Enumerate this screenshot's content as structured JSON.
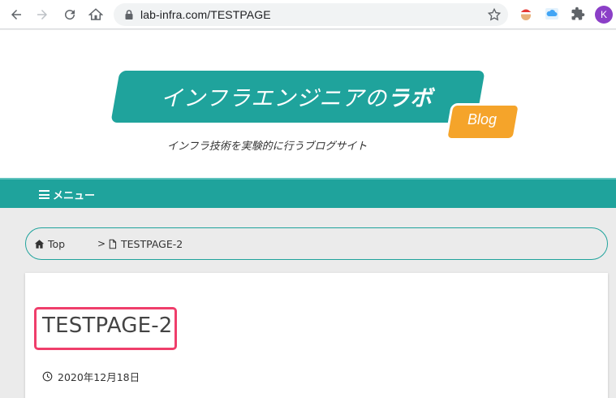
{
  "browser": {
    "url": "lab-infra.com/TESTPAGE",
    "profile_initial": "K",
    "icons": [
      "back-icon",
      "forward-icon",
      "reload-icon",
      "home-icon",
      "lock-icon",
      "star-icon",
      "extension-santa-icon",
      "extension-cloud-icon",
      "puzzle-icon"
    ]
  },
  "site": {
    "logo_main": "インフラエンジニアの",
    "logo_bold": "ラボ",
    "logo_badge": "Blog",
    "tagline": "インフラ技術を実験的に行うブログサイト",
    "menu_label": "メニュー"
  },
  "breadcrumb": {
    "home_label": "Top",
    "separator": ">",
    "current_label": "TESTPAGE-2"
  },
  "article": {
    "title": "TESTPAGE-2",
    "date": "2020年12月18日"
  },
  "colors": {
    "accent": "#1fa39c",
    "badge": "#f5a42a",
    "highlight": "#ef3e6b"
  }
}
